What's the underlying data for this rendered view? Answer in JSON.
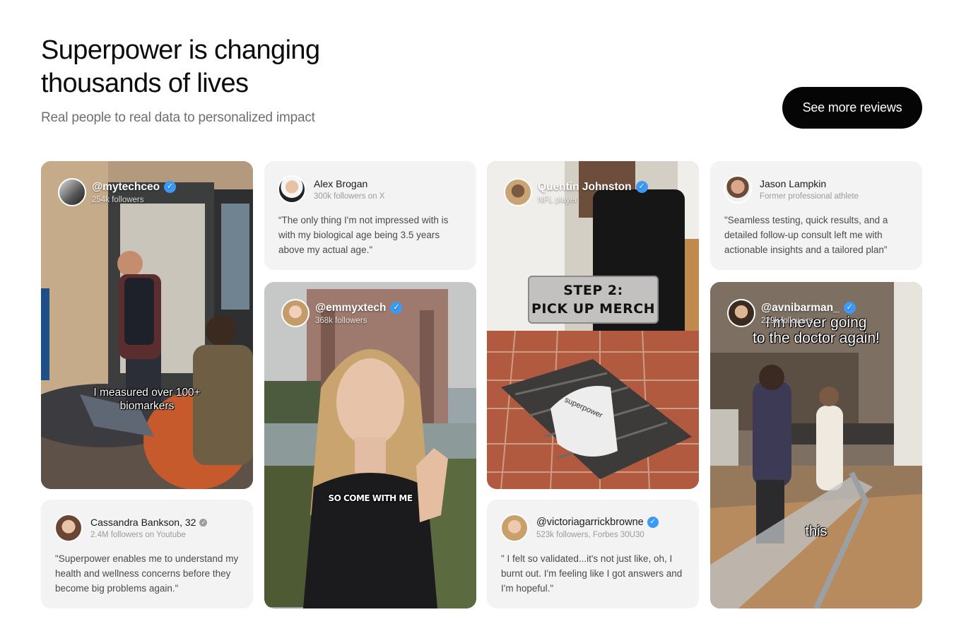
{
  "header": {
    "title_line1": "Superpower is changing",
    "title_line2": "thousands of lives",
    "subtitle": "Real people to real data to personalized impact",
    "cta_label": "See more reviews"
  },
  "colors": {
    "verified": "#3b9af6",
    "cta_bg": "#050505",
    "card_bg": "#f3f3f4"
  },
  "videos": [
    {
      "handle": "@mytechceo",
      "followers": "254k followers",
      "caption_line1": "I measured over 100+",
      "caption_line2": "biomarkers"
    },
    {
      "handle": "@emmyxtech",
      "followers": "368k followers",
      "caption": "SO COME WITH ME"
    },
    {
      "handle": "Quentin Johnston",
      "followers": "NFL player",
      "sign_line1": "STEP 2:",
      "sign_line2": "PICK UP MERCH",
      "bag_text": "superpower"
    },
    {
      "handle": "@avnibarman_",
      "followers": "229k followers",
      "caption_line1": "I'm never going",
      "caption_line2": "to the doctor again!",
      "caption_bottom": "this"
    }
  ],
  "reviews": [
    {
      "name": "Alex Brogan",
      "meta": "300k followers on X",
      "quote": "“The only thing I'm not impressed with is with my biological age being 3.5 years above my actual age.\""
    },
    {
      "name": "Jason Lampkin",
      "meta": "Former professional athlete",
      "quote": "\"Seamless testing, quick results, and a detailed follow-up consult left me with actionable insights and a tailored plan”"
    },
    {
      "name": "Cassandra Bankson, 32",
      "meta": "2.4M followers on Youtube",
      "quote": "\"Superpower enables me to understand my health and wellness concerns before they become big problems again.\""
    },
    {
      "name": "@victoriagarrickbrowne",
      "meta": "523k followers, Forbes 30U30",
      "quote": "\" I felt so validated...it's not just like, oh, I burnt out. I'm feeling like I got answers and I'm hopeful.\""
    }
  ]
}
